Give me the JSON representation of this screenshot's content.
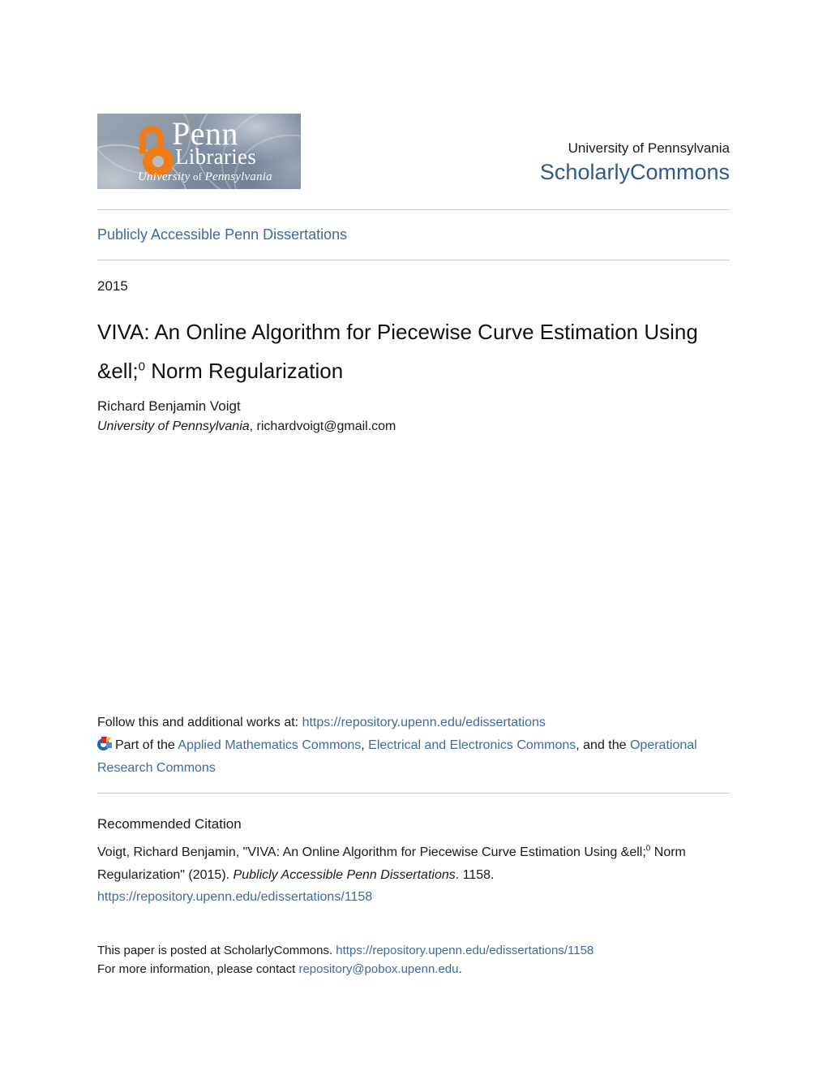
{
  "header": {
    "logo": {
      "alt": "Penn Libraries, University of Pennsylvania",
      "word_penn": "Penn",
      "word_libraries": "Libraries",
      "word_university": "University",
      "word_of": "of",
      "word_pennsylvania": "Pennsylvania"
    },
    "university": "University of Pennsylvania",
    "repository": "ScholarlyCommons"
  },
  "series": {
    "label": "Publicly Accessible Penn Dissertations"
  },
  "document": {
    "year": "2015",
    "title_part1": "VIVA: An Online Algorithm for Piecewise Curve Estimation Using &ell;",
    "title_sup": "0",
    "title_part2": " Norm Regularization",
    "author": "Richard Benjamin Voigt",
    "affiliation": "University of Pennsylvania",
    "affiliation_sep": ", ",
    "email": "richardvoigt@gmail.com"
  },
  "follow": {
    "lead": "Follow this and additional works at: ",
    "url": "https://repository.upenn.edu/edissertations",
    "part_of": "Part of the ",
    "commons": [
      {
        "name": "Applied Mathematics Commons",
        "after": ", "
      },
      {
        "name": "Electrical and Electronics Commons",
        "after": ", and the "
      },
      {
        "name": "Operational Research Commons",
        "after": ""
      }
    ]
  },
  "citation": {
    "heading": "Recommended Citation",
    "text_part1": "Voigt, Richard Benjamin, \"VIVA: An Online Algorithm for Piecewise Curve Estimation Using &ell;",
    "text_sup": "0",
    "text_part2": " Norm Regularization\" (2015). ",
    "series_italic": "Publicly Accessible Penn Dissertations",
    "text_part3": ". 1158.",
    "url": "https://repository.upenn.edu/edissertations/1158"
  },
  "footer": {
    "line1_lead": "This paper is posted at ScholarlyCommons. ",
    "line1_url": "https://repository.upenn.edu/edissertations/1158",
    "line2_lead": "For more information, please contact ",
    "line2_email": "repository@pobox.upenn.edu",
    "line2_end": "."
  },
  "colors": {
    "link": "#3c6ba0",
    "repository_title": "#2d5a8e",
    "rule": "#c9c9c9",
    "logo_accent": "#f07d1a"
  }
}
